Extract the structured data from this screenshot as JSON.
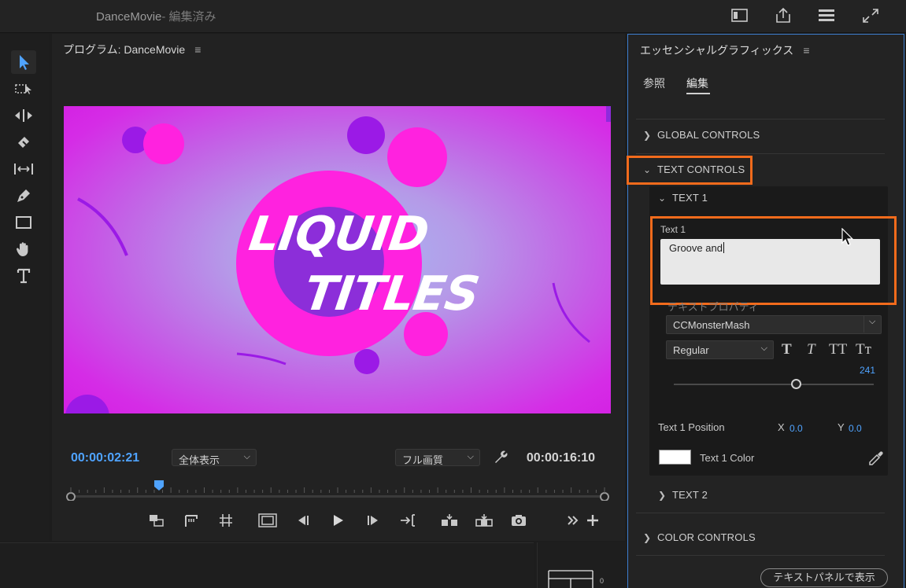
{
  "titlebar": {
    "app_title": "DanceMovie",
    "status": "- 編集済み",
    "icons": [
      "panel-layout-icon",
      "export-icon",
      "workspaces-icon",
      "fullscreen-icon"
    ]
  },
  "tools": [
    "selection-tool-icon",
    "track-select-tool-icon",
    "ripple-edit-tool-icon",
    "razor-tool-icon",
    "slip-tool-icon",
    "pen-tool-icon",
    "rectangle-tool-icon",
    "hand-tool-icon",
    "type-tool-icon"
  ],
  "program": {
    "header": "プログラム: DanceMovie",
    "video_title_line1": "LIQUID",
    "video_title_line2": "TITLES",
    "timecode_current": "00:00:02:21",
    "timecode_duration": "00:00:16:10",
    "zoom_select": "全体表示",
    "quality_select": "フル画質",
    "playhead_fraction": 0.165
  },
  "essential_graphics": {
    "title": "エッセンシャルグラフィックス",
    "tabs": [
      "参照",
      "編集"
    ],
    "active_tab": "編集",
    "sections": {
      "global_controls": "GLOBAL CONTROLS",
      "text_controls": "TEXT CONTROLS",
      "text1": "TEXT 1",
      "text2": "TEXT 2",
      "color_controls": "COLOR CONTROLS"
    },
    "text1_field_label": "Text 1",
    "text1_value": "Groove and",
    "text_properties_label": "テキストプロパティ",
    "font_family": "CCMonsterMash",
    "font_style": "Regular",
    "style_buttons": [
      "T",
      "T",
      "TT",
      "Tт"
    ],
    "font_size": "241",
    "font_size_fraction": 0.61,
    "position_label": "Text 1 Position",
    "x_label": "X",
    "x_value": "0.0",
    "y_label": "Y",
    "y_value": "0.0",
    "color_label": "Text 1 Color",
    "color_value": "#ffffff",
    "panel_button": "テキストパネルで表示"
  },
  "timeline_scale_label": "0",
  "colors": {
    "accent_blue": "#4fa3ff",
    "highlight_orange": "#f26b1c",
    "panel_focus_border": "#3d7fd1"
  }
}
